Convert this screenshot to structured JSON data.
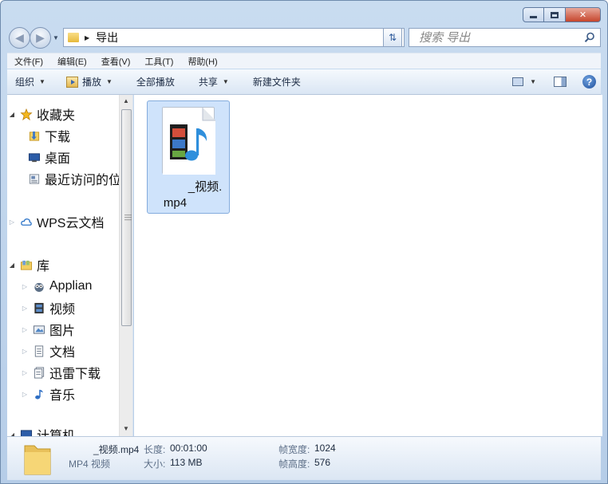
{
  "window": {
    "caption_buttons": [
      "minimize",
      "maximize",
      "close"
    ],
    "accent_color": "#c6452c"
  },
  "navbar": {
    "address_path": "导出",
    "search_placeholder": "搜索 导出"
  },
  "menu": {
    "items": [
      "文件(F)",
      "编辑(E)",
      "查看(V)",
      "工具(T)",
      "帮助(H)"
    ]
  },
  "toolbar": {
    "organize": "组织",
    "play": "播放",
    "play_all": "全部播放",
    "share": "共享",
    "new_folder": "新建文件夹"
  },
  "navpane": {
    "favorites": {
      "label": "收藏夹",
      "items": [
        "下载",
        "桌面",
        "最近访问的位"
      ]
    },
    "wps": {
      "label": "WPS云文档"
    },
    "library": {
      "label": "库",
      "items": [
        "Applian",
        "视频",
        "图片",
        "文档",
        "迅雷下载",
        "音乐"
      ]
    },
    "computer": {
      "label": "计算机"
    }
  },
  "content": {
    "file": {
      "name_line1": "_视频.",
      "name_line2": "mp4",
      "icon": "video-file-icon"
    }
  },
  "details": {
    "filename": "_视频.mp4",
    "type": "MP4 视频",
    "length_label": "长度:",
    "length_value": "00:01:00",
    "size_label": "大小:",
    "size_value": "113 MB",
    "frame_width_label": "帧宽度:",
    "frame_width_value": "1024",
    "frame_height_label": "帧高度:",
    "frame_height_value": "576"
  }
}
